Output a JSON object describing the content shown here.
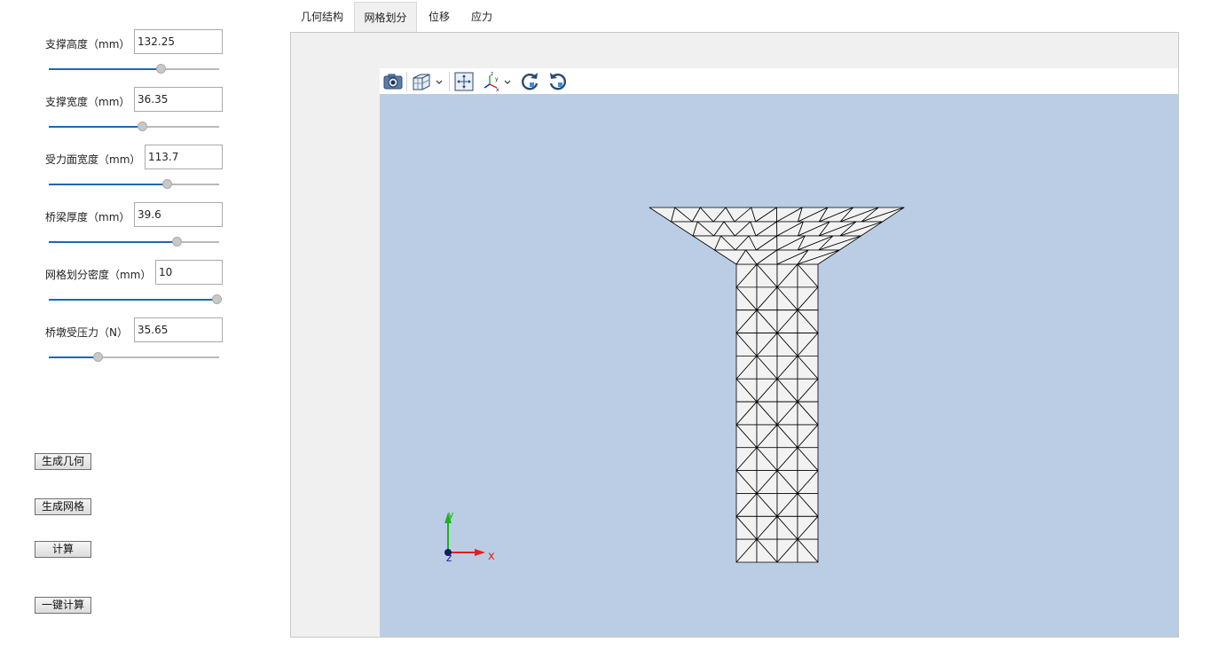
{
  "params": [
    {
      "label": "支撑高度（mm）",
      "value": "132.25",
      "slider_fraction": 0.66
    },
    {
      "label": "支撑宽度（mm）",
      "value": "36.35",
      "slider_fraction": 0.55
    },
    {
      "label": "受力面宽度（mm）",
      "value": "113.7",
      "slider_fraction": 0.7
    },
    {
      "label": "桥梁厚度（mm）",
      "value": "39.6",
      "slider_fraction": 0.76
    },
    {
      "label": "网格划分密度（mm）",
      "value": "10",
      "slider_fraction": 1.0
    },
    {
      "label": "桥墩受压力（N）",
      "value": "35.65",
      "slider_fraction": 0.28
    }
  ],
  "buttons": {
    "generate_geometry": "生成几何",
    "generate_mesh": "生成网格",
    "compute": "计算",
    "one_click_compute": "一键计算"
  },
  "tabs": [
    {
      "label": "几何结构",
      "active": false
    },
    {
      "label": "网格划分",
      "active": true
    },
    {
      "label": "位移",
      "active": false
    },
    {
      "label": "应力",
      "active": false
    }
  ],
  "toolbar_icons": [
    "camera-icon",
    "view-cube-icon",
    "fit-view-icon",
    "axes-orientation-icon",
    "rotate-clockwise-icon",
    "rotate-counterclockwise-icon"
  ],
  "axes": {
    "x": "x",
    "y": "y",
    "z": "z"
  },
  "colors": {
    "viewport_bg": "#bacde4",
    "slider_fill": "#1f68b4",
    "mesh_fill": "#f2f2f2",
    "axis_x": "#e02020",
    "axis_y": "#18b418",
    "axis_z": "#1020b0"
  }
}
